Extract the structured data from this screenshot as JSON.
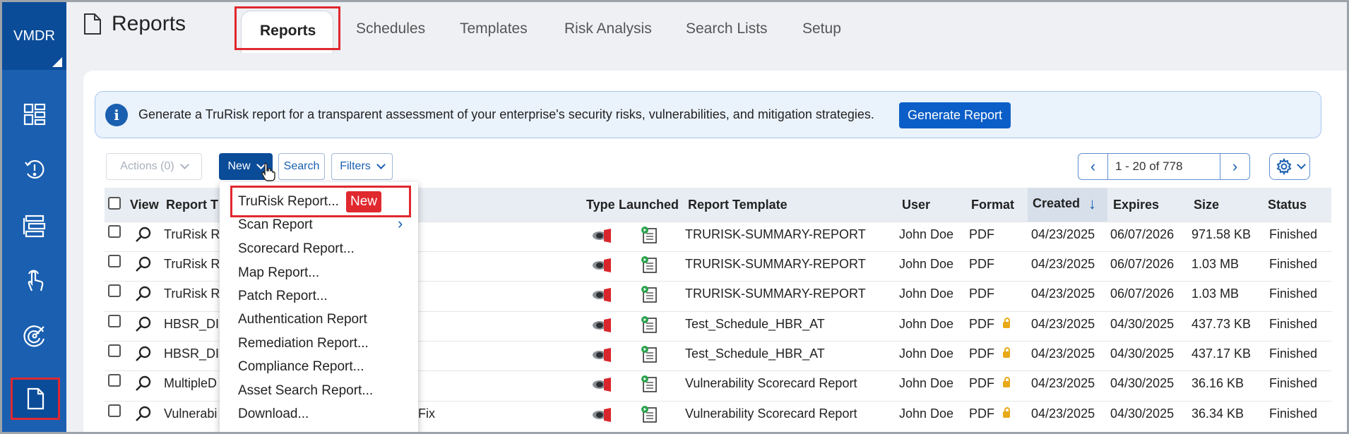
{
  "app": {
    "brand": "VMDR",
    "page_title": "Reports"
  },
  "colors": {
    "brand_blue": "#1a5fb0",
    "dark_blue": "#0b4c99",
    "highlight_red": "#e0282f"
  },
  "sidebar": {
    "items": [
      {
        "icon": "dashboard-icon"
      },
      {
        "icon": "alert-clock-icon"
      },
      {
        "icon": "list-stack-icon"
      },
      {
        "icon": "hand-touch-icon"
      },
      {
        "icon": "radar-icon"
      },
      {
        "icon": "document-icon",
        "active": true
      }
    ]
  },
  "tabs": [
    {
      "label": "Reports",
      "active": true
    },
    {
      "label": "Schedules"
    },
    {
      "label": "Templates"
    },
    {
      "label": "Risk Analysis"
    },
    {
      "label": "Search Lists"
    },
    {
      "label": "Setup"
    }
  ],
  "banner": {
    "message": "Generate a TruRisk report for a transparent assessment of your enterprise's security risks, vulnerabilities, and mitigation strategies.",
    "button": "Generate Report"
  },
  "toolbar": {
    "actions": "Actions (0)",
    "new": "New",
    "search": "Search",
    "filters": "Filters"
  },
  "pager": {
    "range": "1 - 20 of 778"
  },
  "table": {
    "columns": {
      "view": "View",
      "report_title": "Report T",
      "type": "Type",
      "launched": "Launched",
      "template": "Report Template",
      "user": "User",
      "format": "Format",
      "created": "Created",
      "expires": "Expires",
      "size": "Size",
      "status": "Status"
    },
    "sort": {
      "column": "created",
      "direction": "desc"
    },
    "rows": [
      {
        "title": "TruRisk R",
        "template": "TRURISK-SUMMARY-REPORT",
        "user": "John Doe",
        "format": "PDF",
        "locked": false,
        "created": "04/23/2025",
        "expires": "06/07/2026",
        "size": "971.58 KB",
        "status": "Finished"
      },
      {
        "title": "TruRisk R",
        "template": "TRURISK-SUMMARY-REPORT",
        "user": "John Doe",
        "format": "PDF",
        "locked": false,
        "created": "04/23/2025",
        "expires": "06/07/2026",
        "size": "1.03 MB",
        "status": "Finished"
      },
      {
        "title": "TruRisk R",
        "template": "TRURISK-SUMMARY-REPORT",
        "user": "John Doe",
        "format": "PDF",
        "locked": false,
        "created": "04/23/2025",
        "expires": "06/07/2026",
        "size": "1.03 MB",
        "status": "Finished"
      },
      {
        "title": "HBSR_DI",
        "template": "Test_Schedule_HBR_AT",
        "user": "John Doe",
        "format": "PDF",
        "locked": true,
        "created": "04/23/2025",
        "expires": "04/30/2025",
        "size": "437.73 KB",
        "status": "Finished"
      },
      {
        "title": "HBSR_DI",
        "template": "Test_Schedule_HBR_AT",
        "user": "John Doe",
        "format": "PDF",
        "locked": true,
        "created": "04/23/2025",
        "expires": "04/30/2025",
        "size": "437.17 KB",
        "status": "Finished"
      },
      {
        "title": "MultipleD",
        "template": "Vulnerability Scorecard Report",
        "user": "John Doe",
        "format": "PDF",
        "locked": true,
        "created": "04/23/2025",
        "expires": "04/30/2025",
        "size": "36.16 KB",
        "status": "Finished"
      },
      {
        "title": "Vulnerabi",
        "title_tail": "Fix",
        "template": "Vulnerability Scorecard Report",
        "user": "John Doe",
        "format": "PDF",
        "locked": true,
        "created": "04/23/2025",
        "expires": "04/30/2025",
        "size": "36.34 KB",
        "status": "Finished"
      }
    ]
  },
  "new_menu": {
    "items": [
      {
        "label": "TruRisk Report...",
        "badge": "New",
        "highlighted": true
      },
      {
        "label": "Scan Report",
        "submenu": true
      },
      {
        "label": "Scorecard Report..."
      },
      {
        "label": "Map Report..."
      },
      {
        "label": "Patch Report..."
      },
      {
        "label": "Authentication Report"
      },
      {
        "label": "Remediation Report..."
      },
      {
        "label": "Compliance Report..."
      },
      {
        "label": "Asset Search Report..."
      },
      {
        "label": "Download..."
      }
    ]
  }
}
